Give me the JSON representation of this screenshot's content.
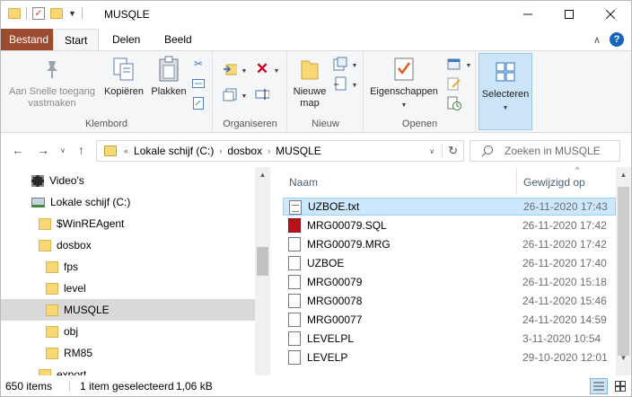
{
  "window": {
    "title": "MUSQLE",
    "minimize_icon": "minimize",
    "maximize_icon": "maximize",
    "close_icon": "close"
  },
  "ribbon_tabs": {
    "file": "Bestand",
    "start": "Start",
    "share": "Delen",
    "view": "Beeld"
  },
  "ribbon": {
    "pin_label": "Aan Snelle toegang vastmaken",
    "copy_label": "Kopiëren",
    "paste_label": "Plakken",
    "clipboard_group": "Klembord",
    "organize_group": "Organiseren",
    "new_folder_label": "Nieuwe map",
    "new_group": "Nieuw",
    "properties_label": "Eigenschappen",
    "open_group": "Openen",
    "select_label": "Selecteren"
  },
  "address": {
    "crumbs": [
      "Lokale schijf (C:)",
      "dosbox",
      "MUSQLE"
    ],
    "search_placeholder": "Zoeken in MUSQLE"
  },
  "tree": [
    {
      "label": "Video's",
      "indent": 0,
      "icon": "video-icon"
    },
    {
      "label": "Lokale schijf (C:)",
      "indent": 0,
      "icon": "drive-icon"
    },
    {
      "label": "$WinREAgent",
      "indent": 1,
      "icon": "folder-icon"
    },
    {
      "label": "dosbox",
      "indent": 1,
      "icon": "folder-icon"
    },
    {
      "label": "fps",
      "indent": 2,
      "icon": "folder-icon"
    },
    {
      "label": "level",
      "indent": 2,
      "icon": "folder-icon"
    },
    {
      "label": "MUSQLE",
      "indent": 2,
      "icon": "folder-icon",
      "selected": true
    },
    {
      "label": "obj",
      "indent": 2,
      "icon": "folder-icon"
    },
    {
      "label": "RM85",
      "indent": 2,
      "icon": "folder-icon"
    },
    {
      "label": "export",
      "indent": 1,
      "icon": "folder-icon"
    }
  ],
  "columns": {
    "name": "Naam",
    "date": "Gewijzigd op"
  },
  "files": [
    {
      "name": "UZBOE.txt",
      "date": "26-11-2020 17:43",
      "type": "txt",
      "selected": true
    },
    {
      "name": "MRG00079.SQL",
      "date": "26-11-2020 17:42",
      "type": "sql"
    },
    {
      "name": "MRG00079.MRG",
      "date": "26-11-2020 17:42",
      "type": "file"
    },
    {
      "name": "UZBOE",
      "date": "26-11-2020 17:40",
      "type": "file"
    },
    {
      "name": "MRG00079",
      "date": "26-11-2020 15:18",
      "type": "file"
    },
    {
      "name": "MRG00078",
      "date": "24-11-2020 15:46",
      "type": "file"
    },
    {
      "name": "MRG00077",
      "date": "24-11-2020 14:59",
      "type": "file"
    },
    {
      "name": "LEVELPL",
      "date": "3-11-2020 10:54",
      "type": "file"
    },
    {
      "name": "LEVELP",
      "date": "29-10-2020 12:01",
      "type": "file"
    }
  ],
  "status": {
    "count": "650 items",
    "selection": "1 item geselecteerd",
    "size": "1,06 kB"
  }
}
